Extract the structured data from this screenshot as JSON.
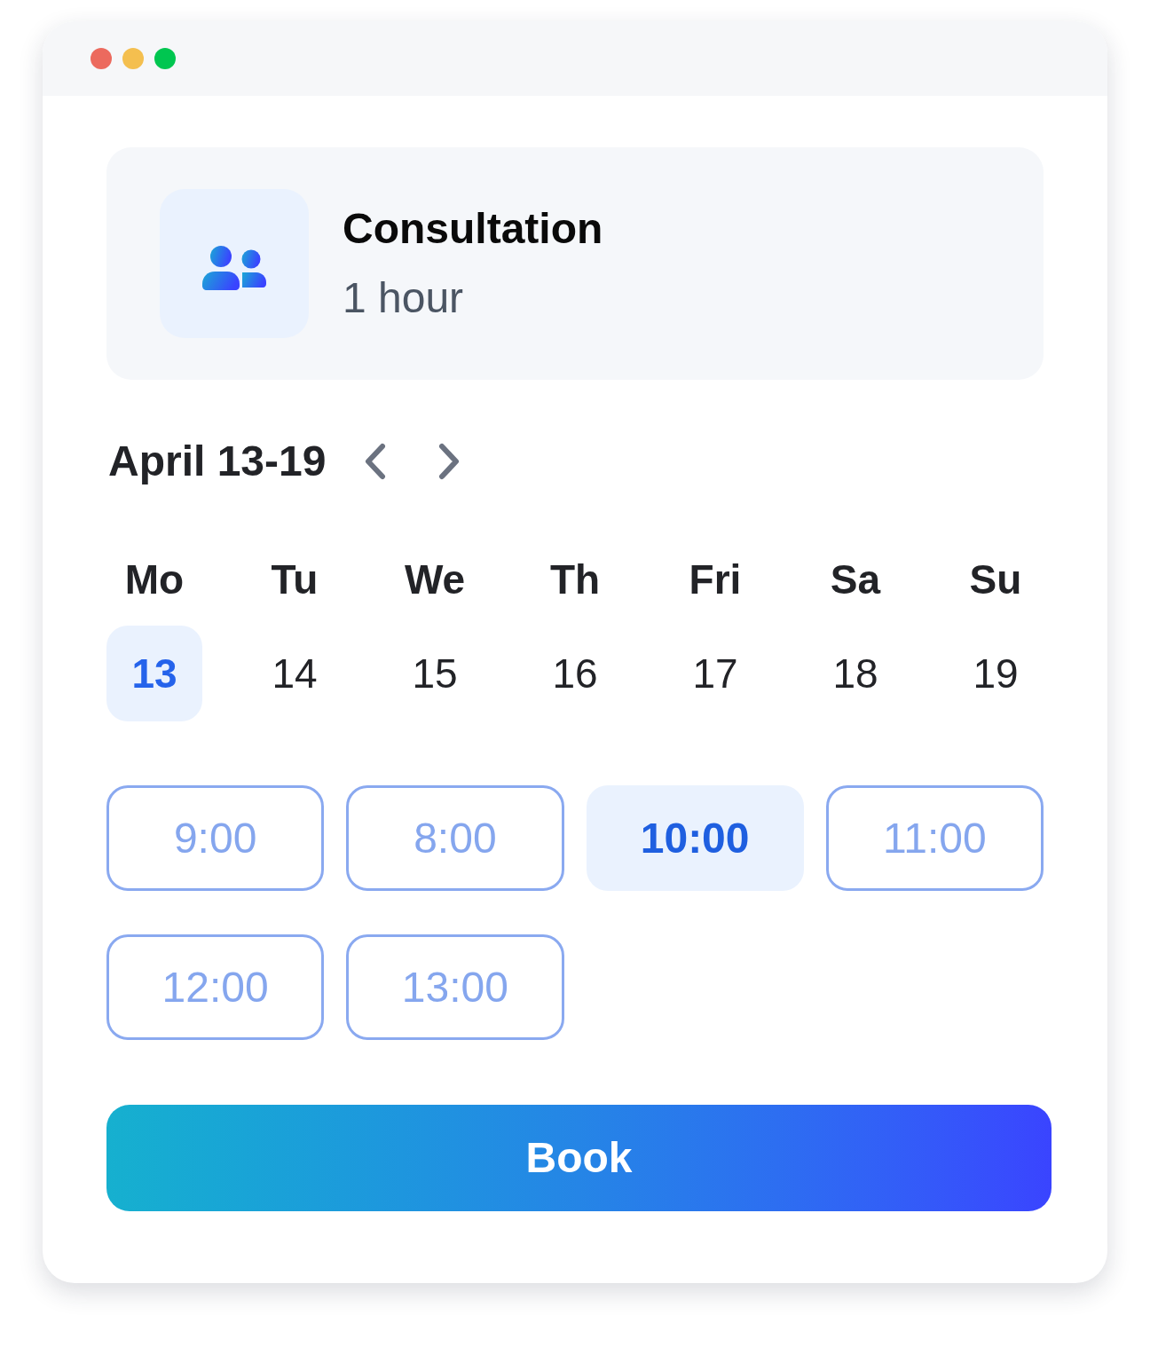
{
  "window": {
    "controls": [
      {
        "color": "#ec6a5e"
      },
      {
        "color": "#f4bf4f"
      },
      {
        "color": "#00c650"
      }
    ]
  },
  "service": {
    "title": "Consultation",
    "duration": "1 hour"
  },
  "week": {
    "label": "April 13-19"
  },
  "days": [
    {
      "weekday": "Mo",
      "date": "13",
      "selected": true
    },
    {
      "weekday": "Tu",
      "date": "14",
      "selected": false
    },
    {
      "weekday": "We",
      "date": "15",
      "selected": false
    },
    {
      "weekday": "Th",
      "date": "16",
      "selected": false
    },
    {
      "weekday": "Fri",
      "date": "17",
      "selected": false
    },
    {
      "weekday": "Sa",
      "date": "18",
      "selected": false
    },
    {
      "weekday": "Su",
      "date": "19",
      "selected": false
    }
  ],
  "time_slots": [
    {
      "label": "9:00",
      "selected": false
    },
    {
      "label": "8:00",
      "selected": false
    },
    {
      "label": "10:00",
      "selected": true
    },
    {
      "label": "11:00",
      "selected": false
    },
    {
      "label": "12:00",
      "selected": false
    },
    {
      "label": "13:00",
      "selected": false
    }
  ],
  "book_button": {
    "label": "Book"
  }
}
